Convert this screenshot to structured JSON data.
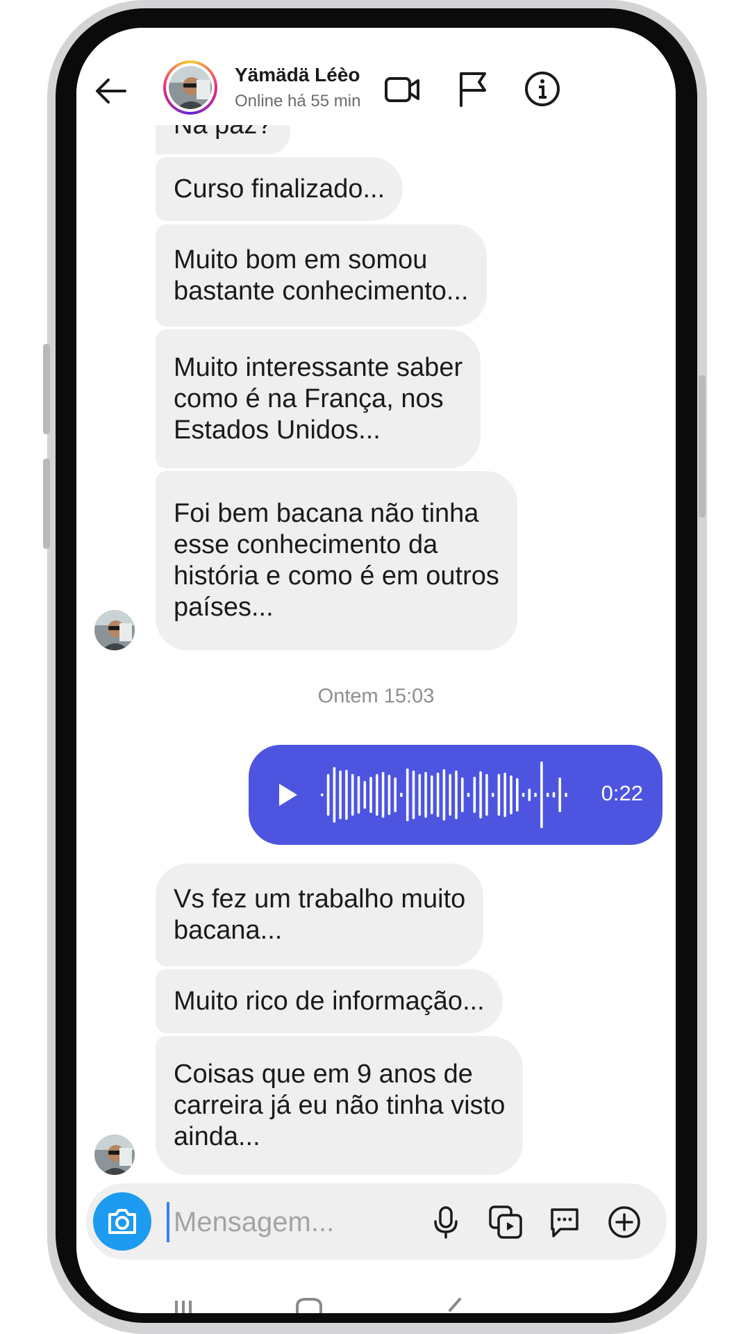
{
  "contact": {
    "name": "Yämädä  Léèo",
    "status": "Online há 55 min"
  },
  "messages_before": [
    {
      "lines": [
        "Na paz?"
      ]
    },
    {
      "lines": [
        "Curso finalizado..."
      ]
    },
    {
      "lines": [
        "Muito bom em somou",
        "bastante conhecimento..."
      ]
    },
    {
      "lines": [
        "Muito interessante saber",
        "como é na França, nos",
        "Estados Unidos..."
      ]
    },
    {
      "lines": [
        "Foi bem bacana não tinha",
        "esse conhecimento da",
        "história e como é em outros",
        "países..."
      ]
    }
  ],
  "timestamp": "Ontem 15:03",
  "voice_message": {
    "duration": "0:22"
  },
  "messages_after": [
    {
      "lines": [
        "Vs fez um trabalho muito",
        "bacana..."
      ]
    },
    {
      "lines": [
        "Muito rico de informação..."
      ]
    },
    {
      "lines": [
        "Coisas que em 9 anos de",
        "carreira já eu não tinha visto",
        "ainda..."
      ]
    }
  ],
  "composer": {
    "placeholder": "Mensagem..."
  },
  "colors": {
    "sent_bubble": "#4d55e0",
    "received_bubble": "#efefef",
    "camera_button": "#1d9bf0",
    "text": "#1a1a1a"
  },
  "icons": {
    "header": [
      "back-arrow-icon",
      "video-call-icon",
      "flag-icon",
      "info-icon"
    ],
    "composer": [
      "camera-icon",
      "microphone-icon",
      "gallery-icon",
      "sticker-chat-icon",
      "plus-icon"
    ]
  }
}
